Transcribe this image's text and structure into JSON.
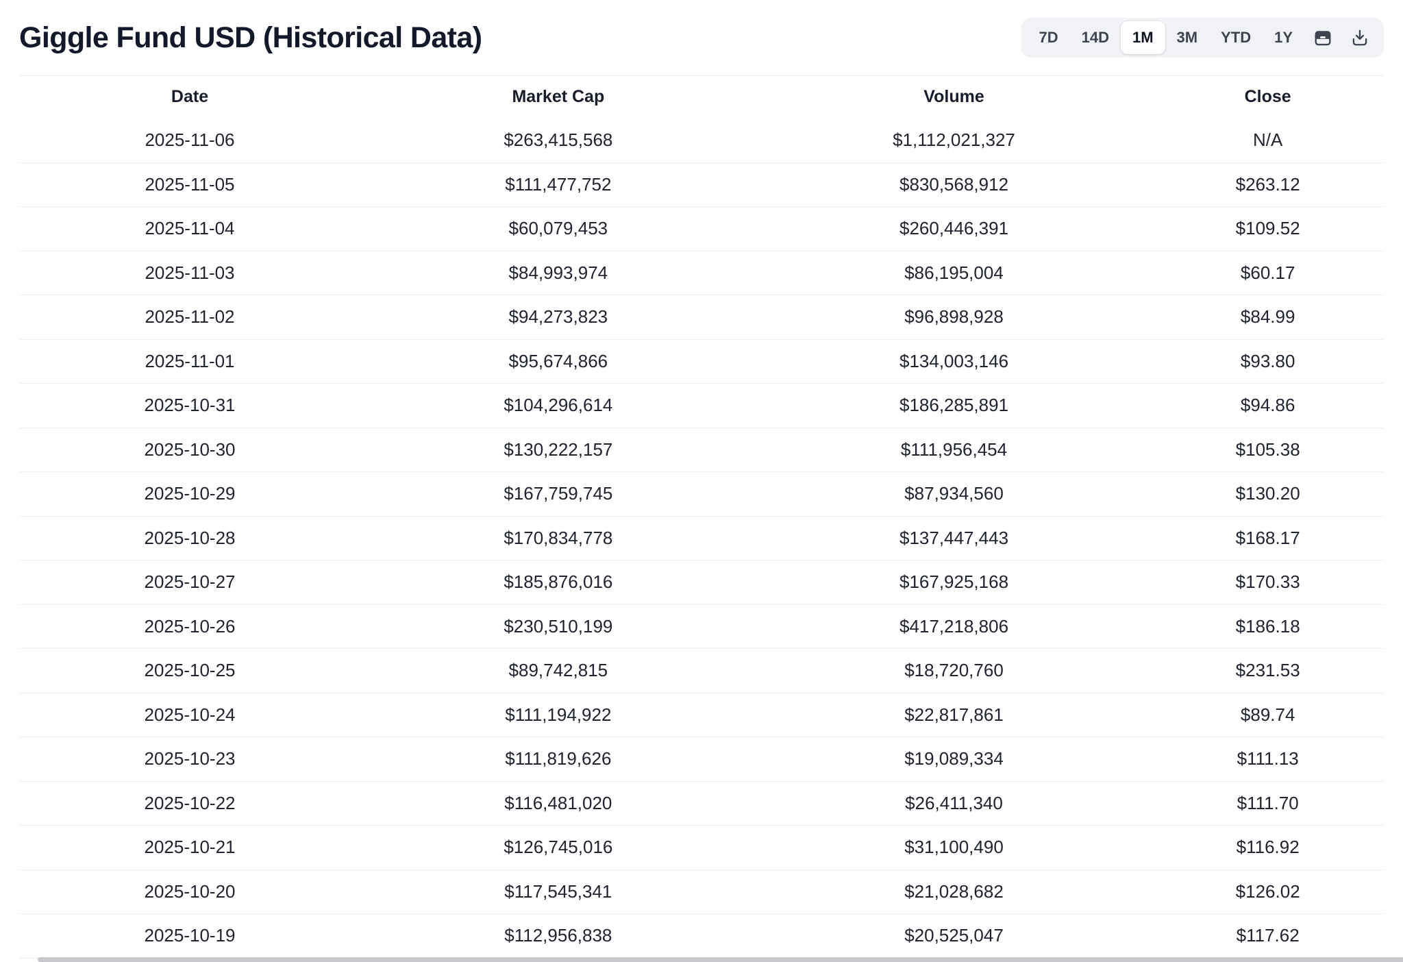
{
  "page": {
    "title": "Giggle Fund USD (Historical Data)"
  },
  "toolbar": {
    "ranges": [
      {
        "label": "7D",
        "active": false
      },
      {
        "label": "14D",
        "active": false
      },
      {
        "label": "1M",
        "active": true
      },
      {
        "label": "3M",
        "active": false
      },
      {
        "label": "YTD",
        "active": false
      },
      {
        "label": "1Y",
        "active": false
      }
    ],
    "icons": [
      {
        "name": "calendar-icon"
      },
      {
        "name": "download-icon"
      }
    ]
  },
  "table": {
    "columns": [
      "Date",
      "Market Cap",
      "Volume",
      "Close"
    ],
    "column_keys": [
      "date",
      "market-cap",
      "volume",
      "close"
    ],
    "rows": [
      [
        "2025-11-06",
        "$263,415,568",
        "$1,112,021,327",
        "N/A"
      ],
      [
        "2025-11-05",
        "$111,477,752",
        "$830,568,912",
        "$263.12"
      ],
      [
        "2025-11-04",
        "$60,079,453",
        "$260,446,391",
        "$109.52"
      ],
      [
        "2025-11-03",
        "$84,993,974",
        "$86,195,004",
        "$60.17"
      ],
      [
        "2025-11-02",
        "$94,273,823",
        "$96,898,928",
        "$84.99"
      ],
      [
        "2025-11-01",
        "$95,674,866",
        "$134,003,146",
        "$93.80"
      ],
      [
        "2025-10-31",
        "$104,296,614",
        "$186,285,891",
        "$94.86"
      ],
      [
        "2025-10-30",
        "$130,222,157",
        "$111,956,454",
        "$105.38"
      ],
      [
        "2025-10-29",
        "$167,759,745",
        "$87,934,560",
        "$130.20"
      ],
      [
        "2025-10-28",
        "$170,834,778",
        "$137,447,443",
        "$168.17"
      ],
      [
        "2025-10-27",
        "$185,876,016",
        "$167,925,168",
        "$170.33"
      ],
      [
        "2025-10-26",
        "$230,510,199",
        "$417,218,806",
        "$186.18"
      ],
      [
        "2025-10-25",
        "$89,742,815",
        "$18,720,760",
        "$231.53"
      ],
      [
        "2025-10-24",
        "$111,194,922",
        "$22,817,861",
        "$89.74"
      ],
      [
        "2025-10-23",
        "$111,819,626",
        "$19,089,334",
        "$111.13"
      ],
      [
        "2025-10-22",
        "$116,481,020",
        "$26,411,340",
        "$111.70"
      ],
      [
        "2025-10-21",
        "$126,745,016",
        "$31,100,490",
        "$116.92"
      ],
      [
        "2025-10-20",
        "$117,545,341",
        "$21,028,682",
        "$126.02"
      ],
      [
        "2025-10-19",
        "$112,956,838",
        "$20,525,047",
        "$117.62"
      ]
    ]
  },
  "colors": {
    "background": "#ffffff",
    "title_text": "#14182b",
    "toolbar_bg": "#f1f2f6",
    "active_pill_bg": "#ffffff",
    "cell_text": "#20242f",
    "row_border": "#f0f1f4",
    "scrollbar_thumb": "#c6c8cc"
  }
}
